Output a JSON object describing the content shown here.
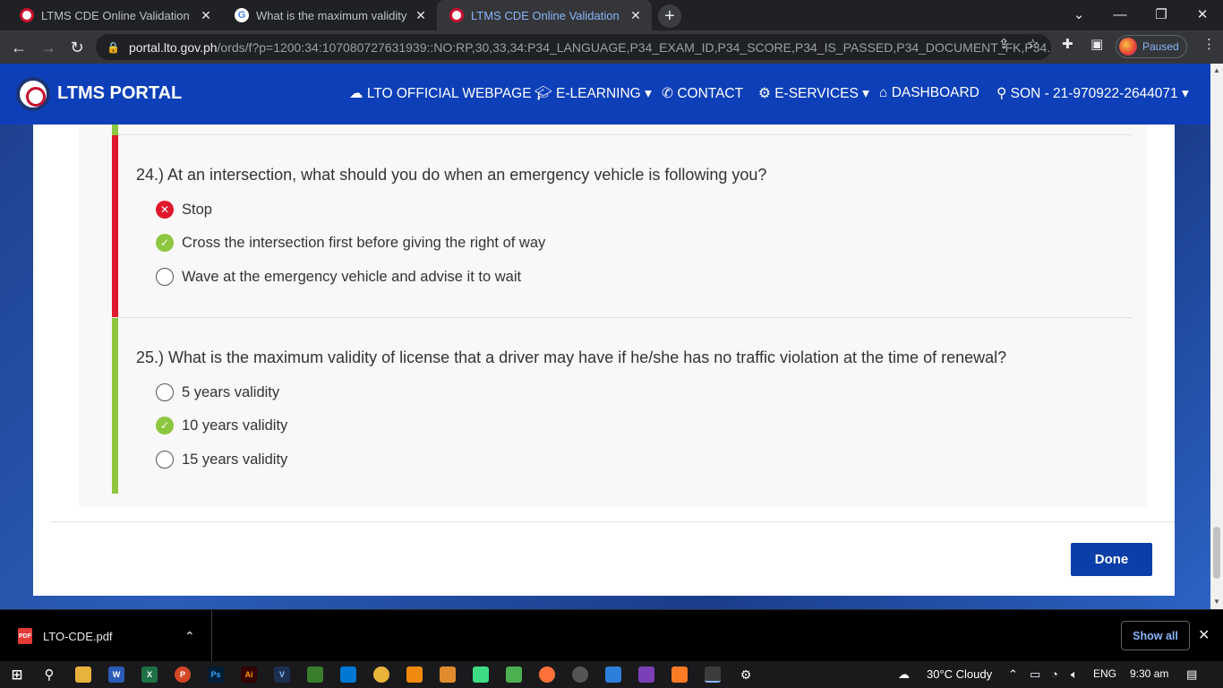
{
  "browser": {
    "tabs": [
      {
        "title": "LTMS CDE Online Validation Exam"
      },
      {
        "title": "What is the maximum validity of"
      },
      {
        "title": "LTMS CDE Online Validation Exam"
      }
    ],
    "new_tab": "+",
    "url_host": "portal.lto.gov.ph",
    "url_path": "/ords/f?p=1200:34:107080727631939::NO:RP,30,33,34:P34_LANGUAGE,P34_EXAM_ID,P34_SCORE,P34_IS_PASSED,P34_DOCUMENT_FK,P34...",
    "profile_label": "Paused"
  },
  "portal": {
    "brand": "LTMS PORTAL",
    "nav": {
      "official": "LTO OFFICIAL WEBPAGE",
      "elearning": "E-LEARNING",
      "contact": "CONTACT",
      "eservices": "E-SERVICES",
      "dashboard": "DASHBOARD",
      "user": "SON - 21-970922-2644071"
    }
  },
  "questions": [
    {
      "text": "24.) At an intersection, what should you do when an emergency vehicle is following you?",
      "status": "wrong",
      "options": [
        {
          "label": "Stop",
          "state": "wrong"
        },
        {
          "label": "Cross the intersection first before giving the right of way",
          "state": "correct"
        },
        {
          "label": "Wave at the emergency vehicle and advise it to wait",
          "state": "none"
        }
      ]
    },
    {
      "text": "25.) What is the maximum validity of license that a driver may have if he/she has no traffic violation at the time of renewal?",
      "status": "correct",
      "options": [
        {
          "label": "5 years validity",
          "state": "none"
        },
        {
          "label": "10 years validity",
          "state": "correct"
        },
        {
          "label": "15 years validity",
          "state": "none"
        }
      ]
    }
  ],
  "done_label": "Done",
  "download": {
    "filename": "LTO-CDE.pdf",
    "show_all": "Show all"
  },
  "taskbar": {
    "weather": "30°C  Cloudy",
    "lang": "ENG",
    "time": "9:30 am"
  },
  "colors": {
    "wrong": "#e0182d",
    "correct": "#8dc63f",
    "nav": "#0d3fb8",
    "button": "#0b3ea8"
  }
}
